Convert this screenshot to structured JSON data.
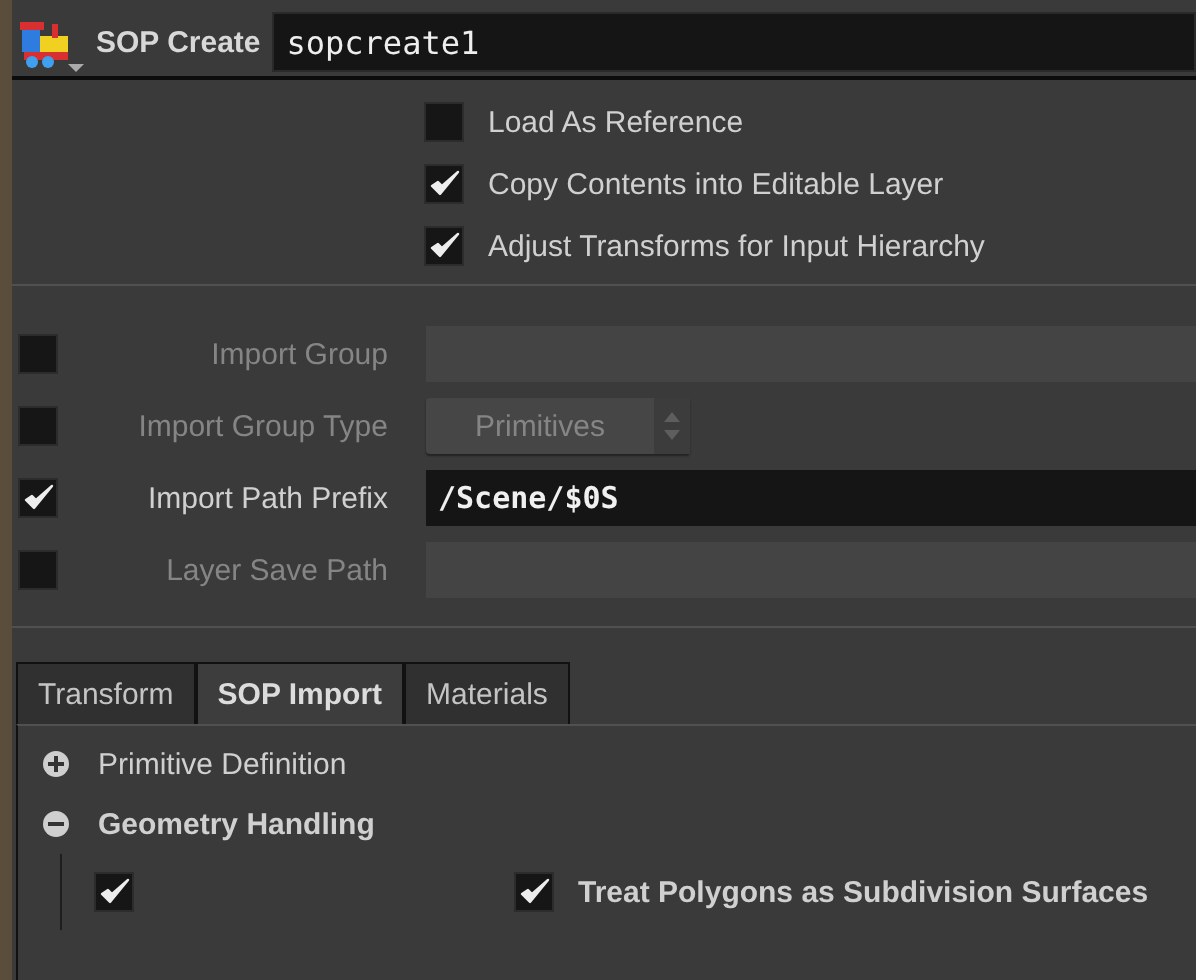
{
  "node": {
    "type": "SOP Create",
    "name": "sopcreate1"
  },
  "toggles": [
    {
      "label": "Load As Reference",
      "checked": false
    },
    {
      "label": "Copy Contents into Editable Layer",
      "checked": true
    },
    {
      "label": "Adjust Transforms for Input Hierarchy",
      "checked": true
    }
  ],
  "params": [
    {
      "kind": "text",
      "label": "Import Group",
      "checked": false
    },
    {
      "kind": "menu",
      "label": "Import Group Type",
      "checked": false,
      "value": "Primitives"
    },
    {
      "kind": "text",
      "label": "Import Path Prefix",
      "checked": true,
      "value": "/Scene/$0S"
    },
    {
      "kind": "text",
      "label": "Layer Save Path",
      "checked": false
    }
  ],
  "tabs": [
    {
      "label": "Transform",
      "selected": false
    },
    {
      "label": "SOP Import",
      "selected": true
    },
    {
      "label": "Materials",
      "selected": false
    }
  ],
  "folders": [
    {
      "label": "Primitive Definition",
      "expanded": false
    },
    {
      "label": "Geometry Handling",
      "expanded": true,
      "rows": [
        {
          "enable_checked": true,
          "label": "Treat Polygons as Subdivision Surfaces",
          "checked": true
        }
      ]
    }
  ]
}
